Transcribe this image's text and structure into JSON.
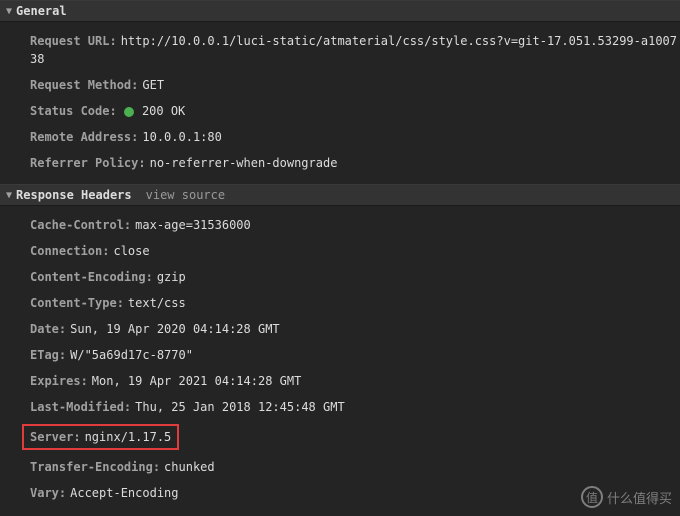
{
  "general": {
    "title": "General",
    "items": [
      {
        "key": "Request URL:",
        "value": "http://10.0.0.1/luci-static/atmaterial/css/style.css?v=git-17.051.53299-a100738"
      },
      {
        "key": "Request Method:",
        "value": "GET"
      },
      {
        "key": "Status Code:",
        "value": "200 OK",
        "status": true
      },
      {
        "key": "Remote Address:",
        "value": "10.0.0.1:80"
      },
      {
        "key": "Referrer Policy:",
        "value": "no-referrer-when-downgrade"
      }
    ]
  },
  "response": {
    "title": "Response Headers",
    "view_source": "view source",
    "items": [
      {
        "key": "Cache-Control:",
        "value": "max-age=31536000"
      },
      {
        "key": "Connection:",
        "value": "close"
      },
      {
        "key": "Content-Encoding:",
        "value": "gzip"
      },
      {
        "key": "Content-Type:",
        "value": "text/css"
      },
      {
        "key": "Date:",
        "value": "Sun, 19 Apr 2020 04:14:28 GMT"
      },
      {
        "key": "ETag:",
        "value": "W/\"5a69d17c-8770\""
      },
      {
        "key": "Expires:",
        "value": "Mon, 19 Apr 2021 04:14:28 GMT"
      },
      {
        "key": "Last-Modified:",
        "value": "Thu, 25 Jan 2018 12:45:48 GMT"
      },
      {
        "key": "Server:",
        "value": "nginx/1.17.5",
        "highlight": true
      },
      {
        "key": "Transfer-Encoding:",
        "value": "chunked"
      },
      {
        "key": "Vary:",
        "value": "Accept-Encoding"
      }
    ]
  },
  "watermark": {
    "icon": "值",
    "text": "什么值得买"
  }
}
